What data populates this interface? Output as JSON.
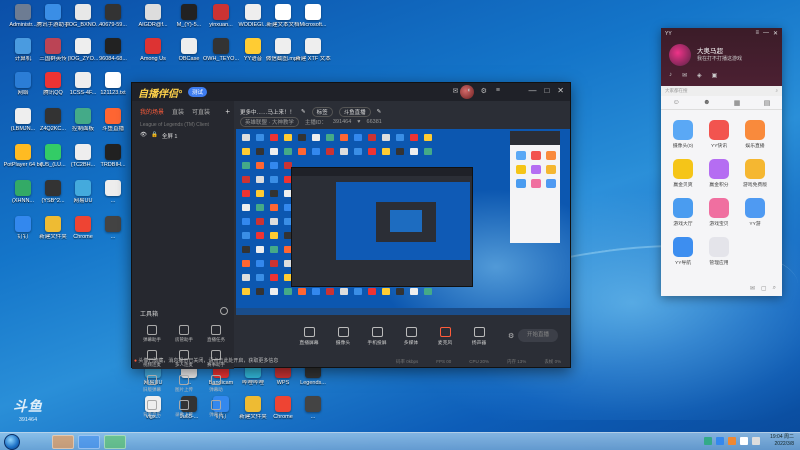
{
  "desktop": {
    "icons": [
      {
        "label": "Administr...",
        "color": "#6d7c93"
      },
      {
        "label": "腾讯手游助手",
        "color": "#3a8ee6"
      },
      {
        "label": "(IOG_BXNO...",
        "color": "#e8e8e8"
      },
      {
        "label": "40679-59...",
        "color": "#333"
      },
      {
        "label": "AIGDR@f...",
        "color": "#ddd"
      },
      {
        "label": "M_(Y)-5...",
        "color": "#222"
      },
      {
        "label": "yinxuan...",
        "color": "#c33"
      },
      {
        "label": "WODIEGI...",
        "color": "#eee"
      },
      {
        "label": "新建文本文档",
        "color": "#fff"
      },
      {
        "label": "Microsoft...",
        "color": "#fff"
      },
      {
        "label": "计算机",
        "color": "#4a9be0"
      },
      {
        "label": "三国群英传",
        "color": "#b45"
      },
      {
        "label": "(IOG_ZYO...",
        "color": "#eee"
      },
      {
        "label": "96084-68...",
        "color": "#222"
      },
      {
        "label": "Among Us",
        "color": "#d33"
      },
      {
        "label": "OBCase",
        "color": "#eee"
      },
      {
        "label": "OWH_TEYO...",
        "color": "#333"
      },
      {
        "label": "YY语音",
        "color": "#fc3"
      },
      {
        "label": "微信截图.mp4",
        "color": "#eee"
      },
      {
        "label": "新建 XTF 文本",
        "color": "#eee"
      },
      {
        "label": "网络",
        "color": "#2b7dd6"
      },
      {
        "label": "腾讯QQ",
        "color": "#e33"
      },
      {
        "label": "1CSS-4F...",
        "color": "#eee"
      },
      {
        "label": "121123.txt",
        "color": "#fff"
      },
      {
        "label": "回收站",
        "color": "#cde"
      },
      {
        "label": "腾讯视频",
        "color": "#f63"
      },
      {
        "label": "(J^Q)W...",
        "color": "#555"
      },
      {
        "label": "1617114...",
        "color": "#333"
      },
      {
        "label": "Internet Explorer",
        "color": "#39f"
      },
      {
        "label": "万一视频",
        "color": "#fb2"
      },
      {
        "label": "(LBMJN...",
        "color": "#eee"
      },
      {
        "label": "Z4Q2KC...",
        "color": "#333"
      },
      {
        "label": "控制面板",
        "color": "#4a8"
      },
      {
        "label": "斗鱼直播",
        "color": "#f63"
      },
      {
        "label": "微信...",
        "color": "#2c3"
      },
      {
        "label": "(NOTEP...",
        "color": "#eee"
      },
      {
        "label": "迅雷",
        "color": "#38e"
      },
      {
        "label": "百度网盘",
        "color": "#3ae"
      },
      {
        "label": "(RNCH_N...",
        "color": "#222"
      },
      {
        "label": "(RBQRBK...",
        "color": "#333"
      },
      {
        "label": "PotPlayer 64 bit",
        "color": "#fb2"
      },
      {
        "label": "(U5_(LU...",
        "color": "#3c6"
      },
      {
        "label": "(TC2BH...",
        "color": "#eee"
      },
      {
        "label": "TRDBIH...",
        "color": "#222"
      },
      {
        "label": "Steam",
        "color": "#246"
      },
      {
        "label": "WeGame",
        "color": "#444"
      },
      {
        "label": "(V8EXH...",
        "color": "#eee"
      },
      {
        "label": "(XNCO...",
        "color": "#333"
      },
      {
        "label": "GameMain",
        "color": "#59c"
      },
      {
        "label": "QQ游戏",
        "color": "#fc2"
      },
      {
        "label": "(XHNN...",
        "color": "#3a6"
      },
      {
        "label": "(YSB^2...",
        "color": "#333"
      },
      {
        "label": "网易UU",
        "color": "#4ad"
      },
      {
        "label": "...",
        "color": "#eee"
      },
      {
        "label": "Bandicam",
        "color": "#e33"
      },
      {
        "label": "哔哩哔哩",
        "color": "#3bd"
      },
      {
        "label": "WPS",
        "color": "#c33"
      },
      {
        "label": "Legends...",
        "color": "#333"
      },
      {
        "label": "vlgx...",
        "color": "#eee"
      },
      {
        "label": "9u65-...",
        "color": "#333"
      },
      {
        "label": "钉钉",
        "color": "#38e"
      },
      {
        "label": "新建文件夹",
        "color": "#eb3"
      },
      {
        "label": "Chrome",
        "color": "#e43"
      },
      {
        "label": "...",
        "color": "#444"
      }
    ]
  },
  "app": {
    "logo": "自播伴侣°",
    "version_badge": "测试",
    "title_controls": [
      "—",
      "□",
      "✕"
    ],
    "left_tabs": [
      "我的场景",
      "直装",
      "可直装"
    ],
    "add_label": "+",
    "scene_hint": "League of Legends (TM) Client",
    "scene_item": "全屏 1",
    "toolbox_title": "工具箱",
    "tools": [
      "弹幕助手",
      "房管助手",
      "直播任务",
      "视频连麦",
      "多人连麦",
      "赛事助手",
      "旧版弹幕",
      "图片上传",
      "弹幕助",
      "背景音乐",
      "录像上传",
      "弹幕录"
    ],
    "notice": "头像已隐藏，消息提示已关闭，请点击此处开启，获取更多信息"
  },
  "stream": {
    "title": "更多中……马上来！！",
    "tag": "标签",
    "tab_label": "斗鱼直播",
    "category": "英雄联盟 · 大神教学",
    "room_label": "主播ID：",
    "room_id": "391464",
    "fans": "66381",
    "start_button": "开始直播"
  },
  "controls": [
    {
      "name": "screen-share",
      "label": "直播屏幕"
    },
    {
      "name": "camera",
      "label": "摄像头"
    },
    {
      "name": "phone-cast",
      "label": "手机投屏"
    },
    {
      "name": "multimedia",
      "label": "多媒体"
    },
    {
      "name": "microphone",
      "label": "麦克风"
    },
    {
      "name": "speaker",
      "label": "扬声器"
    }
  ],
  "status_bar": [
    "码率 0kbps",
    "FPS 00",
    "CPU 20%",
    "内存 13%",
    "丢帧 0%"
  ],
  "side_panel": {
    "brand": "YY",
    "name": "大奥马超",
    "subtitle": "我在打不打播这游戏",
    "search_placeholder": "大家都在搜",
    "apps": [
      {
        "label": "摄像头(0)",
        "color": "#5aa8f5"
      },
      {
        "label": "YY快讯",
        "color": "#f2544f"
      },
      {
        "label": "娱乐直播",
        "color": "#f98a3c"
      },
      {
        "label": "赢金贝爽",
        "color": "#f5c518"
      },
      {
        "label": "赢金积分",
        "color": "#b56df2"
      },
      {
        "label": "游戏免费版",
        "color": "#f5b731"
      },
      {
        "label": "游戏大厅",
        "color": "#4a9cf0"
      },
      {
        "label": "游戏宝贝",
        "color": "#f06fa0"
      },
      {
        "label": "YY游",
        "color": "#4f9af2"
      },
      {
        "label": "YY导航",
        "color": "#3d8ef0"
      },
      {
        "label": "管理应用",
        "color": "#e4e4ea"
      }
    ]
  },
  "taskbar": {
    "clock_time": "19:04 周二",
    "clock_date": "2022/3/8"
  },
  "watermark": {
    "logo": "斗鱼",
    "room": "391464"
  }
}
